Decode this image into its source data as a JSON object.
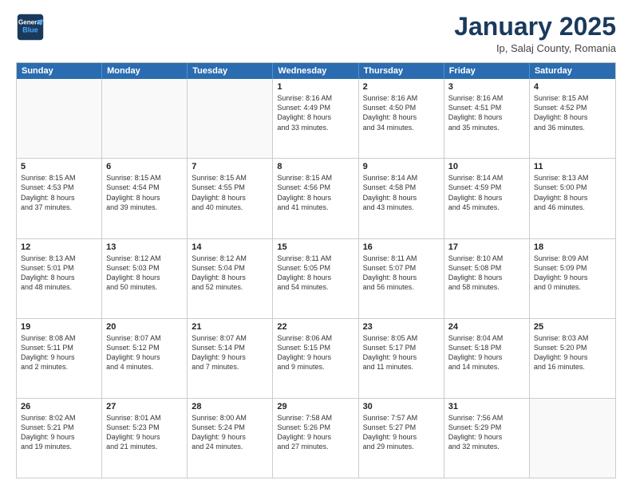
{
  "header": {
    "logo_line1": "General",
    "logo_line2": "Blue",
    "month": "January 2025",
    "location": "Ip, Salaj County, Romania"
  },
  "weekdays": [
    "Sunday",
    "Monday",
    "Tuesday",
    "Wednesday",
    "Thursday",
    "Friday",
    "Saturday"
  ],
  "rows": [
    [
      {
        "day": "",
        "text": ""
      },
      {
        "day": "",
        "text": ""
      },
      {
        "day": "",
        "text": ""
      },
      {
        "day": "1",
        "text": "Sunrise: 8:16 AM\nSunset: 4:49 PM\nDaylight: 8 hours\nand 33 minutes."
      },
      {
        "day": "2",
        "text": "Sunrise: 8:16 AM\nSunset: 4:50 PM\nDaylight: 8 hours\nand 34 minutes."
      },
      {
        "day": "3",
        "text": "Sunrise: 8:16 AM\nSunset: 4:51 PM\nDaylight: 8 hours\nand 35 minutes."
      },
      {
        "day": "4",
        "text": "Sunrise: 8:15 AM\nSunset: 4:52 PM\nDaylight: 8 hours\nand 36 minutes."
      }
    ],
    [
      {
        "day": "5",
        "text": "Sunrise: 8:15 AM\nSunset: 4:53 PM\nDaylight: 8 hours\nand 37 minutes."
      },
      {
        "day": "6",
        "text": "Sunrise: 8:15 AM\nSunset: 4:54 PM\nDaylight: 8 hours\nand 39 minutes."
      },
      {
        "day": "7",
        "text": "Sunrise: 8:15 AM\nSunset: 4:55 PM\nDaylight: 8 hours\nand 40 minutes."
      },
      {
        "day": "8",
        "text": "Sunrise: 8:15 AM\nSunset: 4:56 PM\nDaylight: 8 hours\nand 41 minutes."
      },
      {
        "day": "9",
        "text": "Sunrise: 8:14 AM\nSunset: 4:58 PM\nDaylight: 8 hours\nand 43 minutes."
      },
      {
        "day": "10",
        "text": "Sunrise: 8:14 AM\nSunset: 4:59 PM\nDaylight: 8 hours\nand 45 minutes."
      },
      {
        "day": "11",
        "text": "Sunrise: 8:13 AM\nSunset: 5:00 PM\nDaylight: 8 hours\nand 46 minutes."
      }
    ],
    [
      {
        "day": "12",
        "text": "Sunrise: 8:13 AM\nSunset: 5:01 PM\nDaylight: 8 hours\nand 48 minutes."
      },
      {
        "day": "13",
        "text": "Sunrise: 8:12 AM\nSunset: 5:03 PM\nDaylight: 8 hours\nand 50 minutes."
      },
      {
        "day": "14",
        "text": "Sunrise: 8:12 AM\nSunset: 5:04 PM\nDaylight: 8 hours\nand 52 minutes."
      },
      {
        "day": "15",
        "text": "Sunrise: 8:11 AM\nSunset: 5:05 PM\nDaylight: 8 hours\nand 54 minutes."
      },
      {
        "day": "16",
        "text": "Sunrise: 8:11 AM\nSunset: 5:07 PM\nDaylight: 8 hours\nand 56 minutes."
      },
      {
        "day": "17",
        "text": "Sunrise: 8:10 AM\nSunset: 5:08 PM\nDaylight: 8 hours\nand 58 minutes."
      },
      {
        "day": "18",
        "text": "Sunrise: 8:09 AM\nSunset: 5:09 PM\nDaylight: 9 hours\nand 0 minutes."
      }
    ],
    [
      {
        "day": "19",
        "text": "Sunrise: 8:08 AM\nSunset: 5:11 PM\nDaylight: 9 hours\nand 2 minutes."
      },
      {
        "day": "20",
        "text": "Sunrise: 8:07 AM\nSunset: 5:12 PM\nDaylight: 9 hours\nand 4 minutes."
      },
      {
        "day": "21",
        "text": "Sunrise: 8:07 AM\nSunset: 5:14 PM\nDaylight: 9 hours\nand 7 minutes."
      },
      {
        "day": "22",
        "text": "Sunrise: 8:06 AM\nSunset: 5:15 PM\nDaylight: 9 hours\nand 9 minutes."
      },
      {
        "day": "23",
        "text": "Sunrise: 8:05 AM\nSunset: 5:17 PM\nDaylight: 9 hours\nand 11 minutes."
      },
      {
        "day": "24",
        "text": "Sunrise: 8:04 AM\nSunset: 5:18 PM\nDaylight: 9 hours\nand 14 minutes."
      },
      {
        "day": "25",
        "text": "Sunrise: 8:03 AM\nSunset: 5:20 PM\nDaylight: 9 hours\nand 16 minutes."
      }
    ],
    [
      {
        "day": "26",
        "text": "Sunrise: 8:02 AM\nSunset: 5:21 PM\nDaylight: 9 hours\nand 19 minutes."
      },
      {
        "day": "27",
        "text": "Sunrise: 8:01 AM\nSunset: 5:23 PM\nDaylight: 9 hours\nand 21 minutes."
      },
      {
        "day": "28",
        "text": "Sunrise: 8:00 AM\nSunset: 5:24 PM\nDaylight: 9 hours\nand 24 minutes."
      },
      {
        "day": "29",
        "text": "Sunrise: 7:58 AM\nSunset: 5:26 PM\nDaylight: 9 hours\nand 27 minutes."
      },
      {
        "day": "30",
        "text": "Sunrise: 7:57 AM\nSunset: 5:27 PM\nDaylight: 9 hours\nand 29 minutes."
      },
      {
        "day": "31",
        "text": "Sunrise: 7:56 AM\nSunset: 5:29 PM\nDaylight: 9 hours\nand 32 minutes."
      },
      {
        "day": "",
        "text": ""
      }
    ]
  ]
}
